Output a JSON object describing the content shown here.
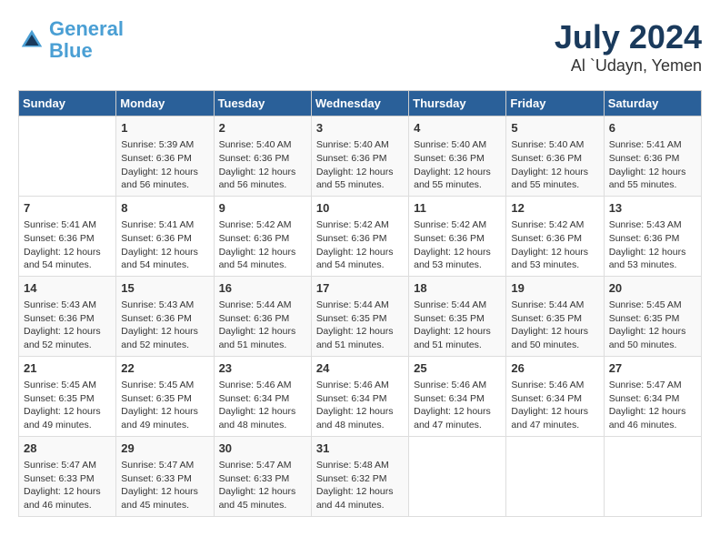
{
  "logo": {
    "text_general": "General",
    "text_blue": "Blue"
  },
  "title": "July 2024",
  "subtitle": "Al `Udayn, Yemen",
  "weekdays": [
    "Sunday",
    "Monday",
    "Tuesday",
    "Wednesday",
    "Thursday",
    "Friday",
    "Saturday"
  ],
  "weeks": [
    [
      {
        "day": "",
        "info": ""
      },
      {
        "day": "1",
        "info": "Sunrise: 5:39 AM\nSunset: 6:36 PM\nDaylight: 12 hours\nand 56 minutes."
      },
      {
        "day": "2",
        "info": "Sunrise: 5:40 AM\nSunset: 6:36 PM\nDaylight: 12 hours\nand 56 minutes."
      },
      {
        "day": "3",
        "info": "Sunrise: 5:40 AM\nSunset: 6:36 PM\nDaylight: 12 hours\nand 55 minutes."
      },
      {
        "day": "4",
        "info": "Sunrise: 5:40 AM\nSunset: 6:36 PM\nDaylight: 12 hours\nand 55 minutes."
      },
      {
        "day": "5",
        "info": "Sunrise: 5:40 AM\nSunset: 6:36 PM\nDaylight: 12 hours\nand 55 minutes."
      },
      {
        "day": "6",
        "info": "Sunrise: 5:41 AM\nSunset: 6:36 PM\nDaylight: 12 hours\nand 55 minutes."
      }
    ],
    [
      {
        "day": "7",
        "info": "Sunrise: 5:41 AM\nSunset: 6:36 PM\nDaylight: 12 hours\nand 54 minutes."
      },
      {
        "day": "8",
        "info": "Sunrise: 5:41 AM\nSunset: 6:36 PM\nDaylight: 12 hours\nand 54 minutes."
      },
      {
        "day": "9",
        "info": "Sunrise: 5:42 AM\nSunset: 6:36 PM\nDaylight: 12 hours\nand 54 minutes."
      },
      {
        "day": "10",
        "info": "Sunrise: 5:42 AM\nSunset: 6:36 PM\nDaylight: 12 hours\nand 54 minutes."
      },
      {
        "day": "11",
        "info": "Sunrise: 5:42 AM\nSunset: 6:36 PM\nDaylight: 12 hours\nand 53 minutes."
      },
      {
        "day": "12",
        "info": "Sunrise: 5:42 AM\nSunset: 6:36 PM\nDaylight: 12 hours\nand 53 minutes."
      },
      {
        "day": "13",
        "info": "Sunrise: 5:43 AM\nSunset: 6:36 PM\nDaylight: 12 hours\nand 53 minutes."
      }
    ],
    [
      {
        "day": "14",
        "info": "Sunrise: 5:43 AM\nSunset: 6:36 PM\nDaylight: 12 hours\nand 52 minutes."
      },
      {
        "day": "15",
        "info": "Sunrise: 5:43 AM\nSunset: 6:36 PM\nDaylight: 12 hours\nand 52 minutes."
      },
      {
        "day": "16",
        "info": "Sunrise: 5:44 AM\nSunset: 6:36 PM\nDaylight: 12 hours\nand 51 minutes."
      },
      {
        "day": "17",
        "info": "Sunrise: 5:44 AM\nSunset: 6:35 PM\nDaylight: 12 hours\nand 51 minutes."
      },
      {
        "day": "18",
        "info": "Sunrise: 5:44 AM\nSunset: 6:35 PM\nDaylight: 12 hours\nand 51 minutes."
      },
      {
        "day": "19",
        "info": "Sunrise: 5:44 AM\nSunset: 6:35 PM\nDaylight: 12 hours\nand 50 minutes."
      },
      {
        "day": "20",
        "info": "Sunrise: 5:45 AM\nSunset: 6:35 PM\nDaylight: 12 hours\nand 50 minutes."
      }
    ],
    [
      {
        "day": "21",
        "info": "Sunrise: 5:45 AM\nSunset: 6:35 PM\nDaylight: 12 hours\nand 49 minutes."
      },
      {
        "day": "22",
        "info": "Sunrise: 5:45 AM\nSunset: 6:35 PM\nDaylight: 12 hours\nand 49 minutes."
      },
      {
        "day": "23",
        "info": "Sunrise: 5:46 AM\nSunset: 6:34 PM\nDaylight: 12 hours\nand 48 minutes."
      },
      {
        "day": "24",
        "info": "Sunrise: 5:46 AM\nSunset: 6:34 PM\nDaylight: 12 hours\nand 48 minutes."
      },
      {
        "day": "25",
        "info": "Sunrise: 5:46 AM\nSunset: 6:34 PM\nDaylight: 12 hours\nand 47 minutes."
      },
      {
        "day": "26",
        "info": "Sunrise: 5:46 AM\nSunset: 6:34 PM\nDaylight: 12 hours\nand 47 minutes."
      },
      {
        "day": "27",
        "info": "Sunrise: 5:47 AM\nSunset: 6:34 PM\nDaylight: 12 hours\nand 46 minutes."
      }
    ],
    [
      {
        "day": "28",
        "info": "Sunrise: 5:47 AM\nSunset: 6:33 PM\nDaylight: 12 hours\nand 46 minutes."
      },
      {
        "day": "29",
        "info": "Sunrise: 5:47 AM\nSunset: 6:33 PM\nDaylight: 12 hours\nand 45 minutes."
      },
      {
        "day": "30",
        "info": "Sunrise: 5:47 AM\nSunset: 6:33 PM\nDaylight: 12 hours\nand 45 minutes."
      },
      {
        "day": "31",
        "info": "Sunrise: 5:48 AM\nSunset: 6:32 PM\nDaylight: 12 hours\nand 44 minutes."
      },
      {
        "day": "",
        "info": ""
      },
      {
        "day": "",
        "info": ""
      },
      {
        "day": "",
        "info": ""
      }
    ]
  ]
}
